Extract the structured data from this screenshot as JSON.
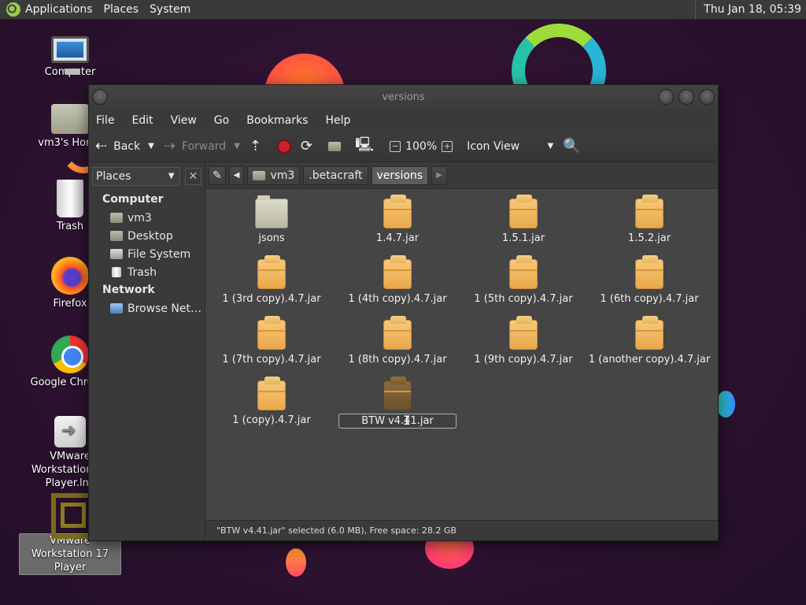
{
  "panel": {
    "menus": [
      "Applications",
      "Places",
      "System"
    ],
    "clock": "Thu Jan 18, 05:39"
  },
  "desktop": {
    "icons": [
      {
        "label": "Computer",
        "icon": "computer-icon"
      },
      {
        "label": "vm3's Home",
        "icon": "home-folder-icon"
      },
      {
        "label": "Trash",
        "icon": "trash-icon"
      },
      {
        "label": "Firefox",
        "icon": "firefox-icon"
      },
      {
        "label": "Google Chrome",
        "icon": "chrome-icon"
      },
      {
        "label": "VMware Workstation 17 Player.lnk",
        "icon": "vmware-shortcut-icon"
      },
      {
        "label": "VMware Workstation 17 Player",
        "icon": "vmware-icon",
        "selected": true
      }
    ]
  },
  "window": {
    "title": "versions",
    "menus": [
      "File",
      "Edit",
      "View",
      "Go",
      "Bookmarks",
      "Help"
    ],
    "toolbar": {
      "back": "Back",
      "forward": "Forward",
      "zoom": "100%",
      "view_mode": "Icon View"
    },
    "sidebar": {
      "selector": "Places",
      "groups": [
        {
          "title": "Computer",
          "items": [
            "vm3",
            "Desktop",
            "File System",
            "Trash"
          ]
        },
        {
          "title": "Network",
          "items": [
            "Browse Net…"
          ]
        }
      ]
    },
    "path": [
      "vm3",
      ".betacraft",
      "versions"
    ],
    "files": [
      {
        "name": "jsons",
        "type": "folder"
      },
      {
        "name": "1.4.7.jar",
        "type": "jar"
      },
      {
        "name": "1.5.1.jar",
        "type": "jar"
      },
      {
        "name": "1.5.2.jar",
        "type": "jar"
      },
      {
        "name": "1 (3rd copy).4.7.jar",
        "type": "jar"
      },
      {
        "name": "1 (4th copy).4.7.jar",
        "type": "jar"
      },
      {
        "name": "1 (5th copy).4.7.jar",
        "type": "jar"
      },
      {
        "name": "1 (6th copy).4.7.jar",
        "type": "jar"
      },
      {
        "name": "1 (7th copy).4.7.jar",
        "type": "jar"
      },
      {
        "name": "1 (8th copy).4.7.jar",
        "type": "jar"
      },
      {
        "name": "1 (9th copy).4.7.jar",
        "type": "jar"
      },
      {
        "name": "1 (another copy).4.7.jar",
        "type": "jar"
      },
      {
        "name": "1 (copy).4.7.jar",
        "type": "jar"
      },
      {
        "name": "BTW v4.41.jar",
        "type": "jar",
        "selected": true
      }
    ],
    "status": "\"BTW v4.41.jar\" selected (6.0 MB), Free space: 28.2 GB"
  }
}
